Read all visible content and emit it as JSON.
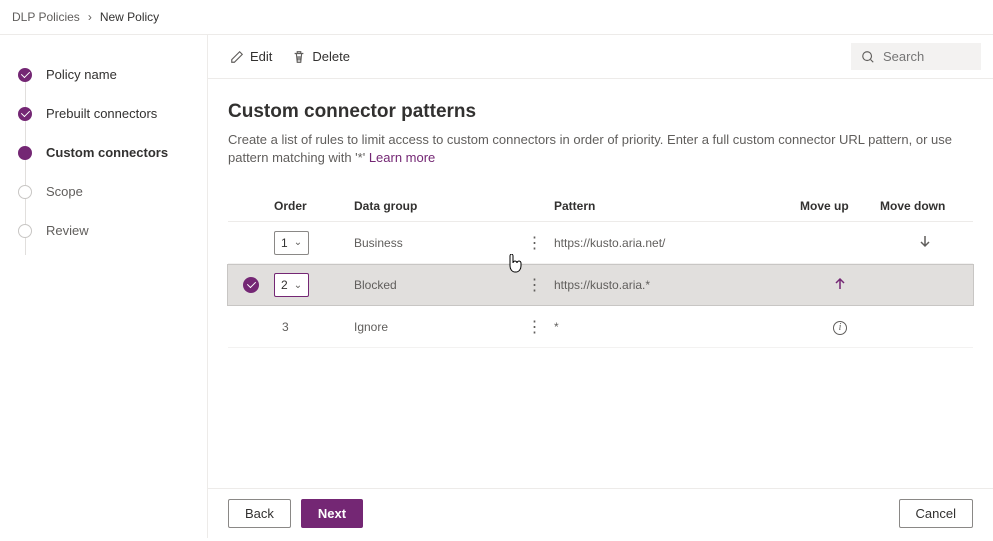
{
  "breadcrumb": {
    "parent": "DLP Policies",
    "sep": "›",
    "current": "New Policy"
  },
  "nav": {
    "steps": [
      {
        "label": "Policy name"
      },
      {
        "label": "Prebuilt connectors"
      },
      {
        "label": "Custom connectors"
      },
      {
        "label": "Scope"
      },
      {
        "label": "Review"
      }
    ]
  },
  "commands": {
    "edit": "Edit",
    "delete": "Delete",
    "search_placeholder": "Search"
  },
  "page": {
    "title": "Custom connector patterns",
    "desc_prefix": "Create a list of rules to limit access to custom connectors in order of priority. Enter a full custom connector URL pattern, or use pattern matching with '*' ",
    "learn_more": "Learn more"
  },
  "table": {
    "headers": {
      "order": "Order",
      "data_group": "Data group",
      "pattern": "Pattern",
      "move_up": "Move up",
      "move_down": "Move down"
    },
    "rows": [
      {
        "order": "1",
        "data_group": "Business",
        "pattern": "https://kusto.aria.net/",
        "selected": false,
        "has_dropdown": true,
        "move_up": false,
        "move_down": true,
        "info": false
      },
      {
        "order": "2",
        "data_group": "Blocked",
        "pattern": "https://kusto.aria.*",
        "selected": true,
        "has_dropdown": true,
        "move_up": true,
        "move_down": false,
        "info": false
      },
      {
        "order": "3",
        "data_group": "Ignore",
        "pattern": "*",
        "selected": false,
        "has_dropdown": false,
        "move_up": false,
        "move_down": false,
        "info": true
      }
    ]
  },
  "footer": {
    "back": "Back",
    "next": "Next",
    "cancel": "Cancel"
  }
}
